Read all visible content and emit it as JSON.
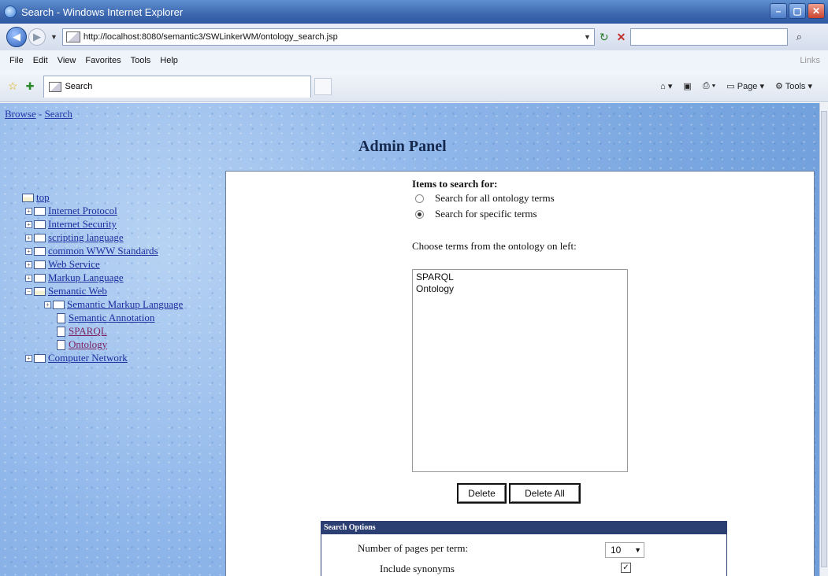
{
  "window": {
    "title": "Search - Windows Internet Explorer"
  },
  "address": {
    "url": "http://localhost:8080/semantic3/SWLinkerWM/ontology_search.jsp",
    "search_placeholder": ""
  },
  "menu": {
    "items": [
      "File",
      "Edit",
      "View",
      "Favorites",
      "Tools",
      "Help"
    ],
    "links_label": "Links"
  },
  "tab": {
    "label": "Search"
  },
  "commands": {
    "page_label": "Page",
    "tools_label": "Tools"
  },
  "breadcrumb": {
    "browse": "Browse",
    "sep": " - ",
    "search": "Search"
  },
  "admin_title": "Admin Panel",
  "tree": {
    "root": "top",
    "items": [
      {
        "label": "Internet Protocol"
      },
      {
        "label": "Internet Security"
      },
      {
        "label": "scripting language"
      },
      {
        "label": "common WWW Standards"
      },
      {
        "label": "Web Service"
      },
      {
        "label": "Markup Language"
      },
      {
        "label": "Semantic Web"
      },
      {
        "label": "Semantic Markup Language"
      },
      {
        "label": "Semantic Annotation"
      },
      {
        "label": "SPARQL"
      },
      {
        "label": "Ontology"
      },
      {
        "label": "Computer Network"
      }
    ]
  },
  "search_panel": {
    "heading": "Items to search for:",
    "radio_all": "Search for all ontology terms",
    "radio_specific": "Search for specific terms",
    "selected_radio": "specific",
    "choose_text": "Choose terms from the ontology on left:",
    "terms": [
      "SPARQL",
      "Ontology"
    ],
    "delete_label": "Delete",
    "delete_all_label": "Delete All"
  },
  "options": {
    "title": "Search Options",
    "pages_label": "Number of pages per term:",
    "pages_value": "10",
    "synonyms_label": "Include synonyms",
    "synonyms_checked": true
  }
}
